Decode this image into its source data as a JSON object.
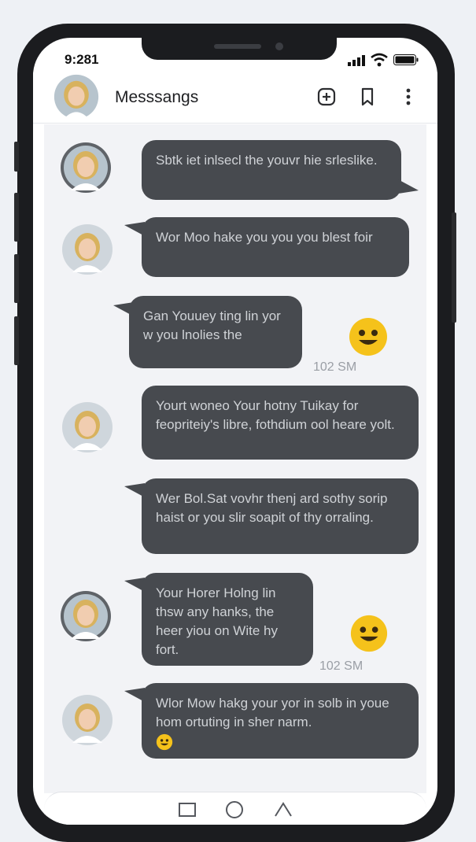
{
  "status_bar": {
    "time": "9:281"
  },
  "header": {
    "title": "Messsangs"
  },
  "messages": [
    {
      "text": "Sbtk iet inlsecl the youvr hie srleslike."
    },
    {
      "text": "Wor Moo hake you you you blest foir"
    },
    {
      "text": "Gan Youuey ting lin yor w you lnolies the",
      "timestamp": "102 SM"
    },
    {
      "text": "Yourt woneo Your hotny Tuikay for feopriteiy's libre, fothdium ool heare yolt."
    },
    {
      "text": "Wer Bol.Sat vovhr thenj ard sothy sorip haist or you slir soapit of thy orraling."
    },
    {
      "text": "Your Horer Holng lin thsw any hanks, the heer yiou on Wite hy fort.",
      "timestamp": "102 SM"
    },
    {
      "text": "Wlor Mow hakg your yor in solb in youe hom ortuting in sher narm."
    }
  ],
  "colors": {
    "bubble": "#474a4f",
    "bubble_text": "#cfd2d6",
    "chat_bg": "#f2f3f6",
    "emoji": "#f5c21b"
  },
  "icons": {
    "compose": "compose-icon",
    "bookmark": "bookmark-icon",
    "more": "more-vertical-icon"
  }
}
